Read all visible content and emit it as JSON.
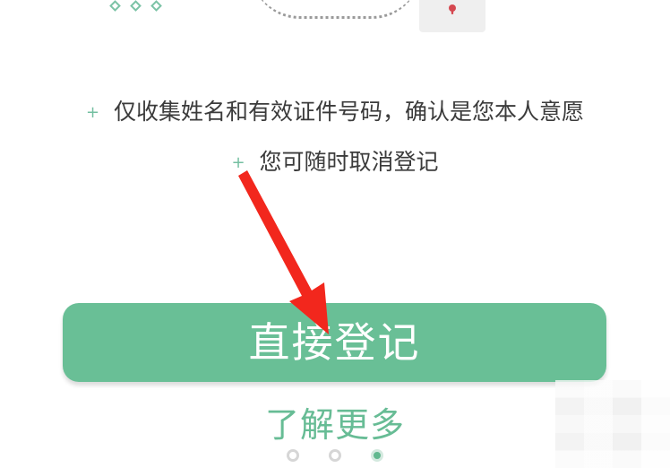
{
  "benefits": [
    "仅收集姓名和有效证件号码，确认是您本人意愿",
    "您可随时取消登记"
  ],
  "actions": {
    "register": "直接登记",
    "learn_more": "了解更多"
  },
  "colors": {
    "accent": "#69bf96",
    "secondary_text": "#67bc95",
    "body_text": "#3b3b3b",
    "annotation_arrow": "#f2271d",
    "lock_red": "#d54850"
  },
  "icons": [
    "diamond-icon",
    "lock-icon",
    "plus-icon",
    "red-arrow-icon",
    "page-indicator-dot"
  ],
  "pager": {
    "page_count": 3,
    "active_index": 3
  }
}
